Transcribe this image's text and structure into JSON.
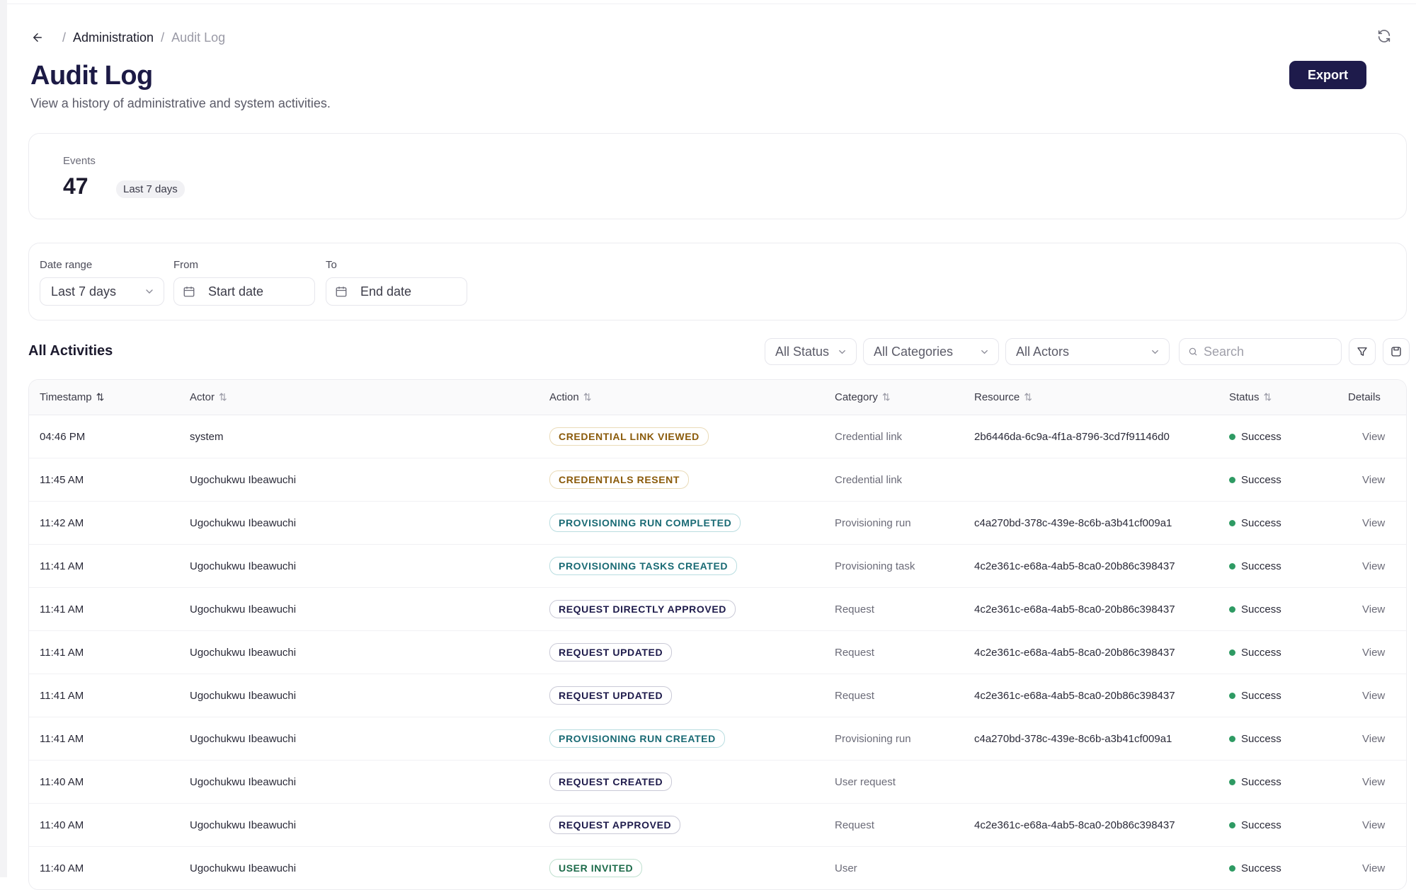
{
  "breadcrumb": {
    "parent": "Administration",
    "current": "Audit Log"
  },
  "header": {
    "title": "Audit Log",
    "subtitle": "View a history of administrative and system activities.",
    "export_label": "Export"
  },
  "events": {
    "label": "Events",
    "count": "47",
    "period": "Last 7 days"
  },
  "filters": {
    "date_range_label": "Date range",
    "date_range_value": "Last 7 days",
    "from_label": "From",
    "from_placeholder": "Start date",
    "to_label": "To",
    "to_placeholder": "End date"
  },
  "activities": {
    "title": "All Activities",
    "status_filter": "All Status",
    "category_filter": "All Categories",
    "actor_filter": "All Actors",
    "search_placeholder": "Search"
  },
  "table": {
    "columns": [
      "Timestamp",
      "Actor",
      "Action",
      "Category",
      "Resource",
      "Status",
      "Details"
    ],
    "rows": [
      {
        "timestamp": "04:46 PM",
        "actor": "system",
        "action": "CREDENTIAL LINK VIEWED",
        "action_tone": "amber",
        "category": "Credential link",
        "resource": "2b6446da-6c9a-4f1a-8796-3cd7f91146d0",
        "status": "Success",
        "details": "View"
      },
      {
        "timestamp": "11:45 AM",
        "actor": "Ugochukwu Ibeawuchi",
        "action": "CREDENTIALS RESENT",
        "action_tone": "amber",
        "category": "Credential link",
        "resource": "",
        "status": "Success",
        "details": "View"
      },
      {
        "timestamp": "11:42 AM",
        "actor": "Ugochukwu Ibeawuchi",
        "action": "PROVISIONING RUN COMPLETED",
        "action_tone": "teal",
        "category": "Provisioning run",
        "resource": "c4a270bd-378c-439e-8c6b-a3b41cf009a1",
        "status": "Success",
        "details": "View"
      },
      {
        "timestamp": "11:41 AM",
        "actor": "Ugochukwu Ibeawuchi",
        "action": "PROVISIONING TASKS CREATED",
        "action_tone": "teal",
        "category": "Provisioning task",
        "resource": "4c2e361c-e68a-4ab5-8ca0-20b86c398437",
        "status": "Success",
        "details": "View"
      },
      {
        "timestamp": "11:41 AM",
        "actor": "Ugochukwu Ibeawuchi",
        "action": "REQUEST DIRECTLY APPROVED",
        "action_tone": "navy",
        "category": "Request",
        "resource": "4c2e361c-e68a-4ab5-8ca0-20b86c398437",
        "status": "Success",
        "details": "View"
      },
      {
        "timestamp": "11:41 AM",
        "actor": "Ugochukwu Ibeawuchi",
        "action": "REQUEST UPDATED",
        "action_tone": "navy",
        "category": "Request",
        "resource": "4c2e361c-e68a-4ab5-8ca0-20b86c398437",
        "status": "Success",
        "details": "View"
      },
      {
        "timestamp": "11:41 AM",
        "actor": "Ugochukwu Ibeawuchi",
        "action": "REQUEST UPDATED",
        "action_tone": "navy",
        "category": "Request",
        "resource": "4c2e361c-e68a-4ab5-8ca0-20b86c398437",
        "status": "Success",
        "details": "View"
      },
      {
        "timestamp": "11:41 AM",
        "actor": "Ugochukwu Ibeawuchi",
        "action": "PROVISIONING RUN CREATED",
        "action_tone": "teal",
        "category": "Provisioning run",
        "resource": "c4a270bd-378c-439e-8c6b-a3b41cf009a1",
        "status": "Success",
        "details": "View"
      },
      {
        "timestamp": "11:40 AM",
        "actor": "Ugochukwu Ibeawuchi",
        "action": "REQUEST CREATED",
        "action_tone": "navy",
        "category": "User request",
        "resource": "",
        "status": "Success",
        "details": "View"
      },
      {
        "timestamp": "11:40 AM",
        "actor": "Ugochukwu Ibeawuchi",
        "action": "REQUEST APPROVED",
        "action_tone": "navy",
        "category": "Request",
        "resource": "4c2e361c-e68a-4ab5-8ca0-20b86c398437",
        "status": "Success",
        "details": "View"
      },
      {
        "timestamp": "11:40 AM",
        "actor": "Ugochukwu Ibeawuchi",
        "action": "USER INVITED",
        "action_tone": "green",
        "category": "User",
        "resource": "",
        "status": "Success",
        "details": "View"
      }
    ]
  },
  "icons": {
    "back": "arrow-left-icon",
    "refresh": "refresh-icon",
    "calendar": "calendar-icon",
    "chevron": "chevron-down-icon",
    "search": "search-icon",
    "filter": "filter-icon",
    "save": "save-icon"
  },
  "colors": {
    "primary": "#1e1b4b",
    "success": "#2e9a63"
  }
}
